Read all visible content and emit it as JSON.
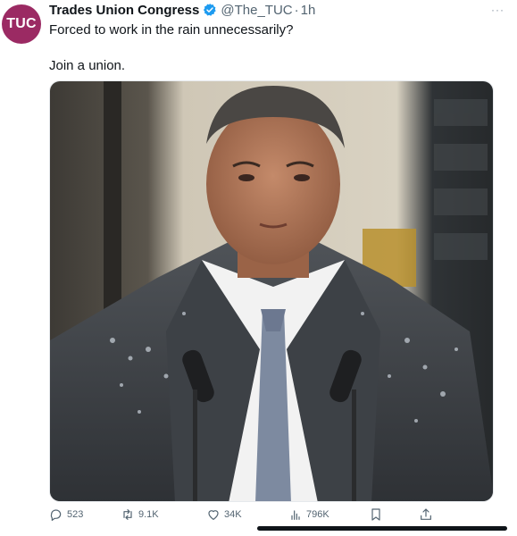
{
  "avatar": {
    "text": "TUC",
    "color": "#9b2a63"
  },
  "tweet": {
    "author": "Trades Union Congress",
    "handle": "@The_TUC",
    "separator": "·",
    "time": "1h",
    "more": "···",
    "lines": [
      "Forced to work in the rain unnecessarily?",
      "Join a union."
    ]
  },
  "actions": {
    "replies": "523",
    "retweets": "9.1K",
    "likes": "34K",
    "views": "796K"
  },
  "icons": {
    "verified": "verified-badge-icon",
    "reply": "reply-icon",
    "retweet": "retweet-icon",
    "like": "heart-icon",
    "views": "views-chart-icon",
    "bookmark": "bookmark-icon",
    "share": "share-icon"
  }
}
